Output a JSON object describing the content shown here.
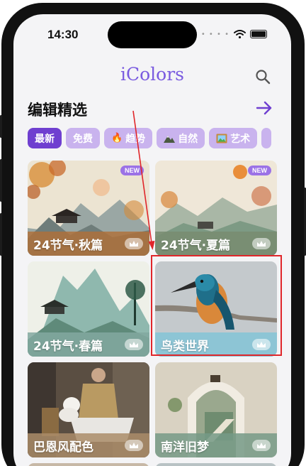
{
  "status_bar": {
    "time": "14:30"
  },
  "header": {
    "logo_text": "iColors",
    "search_icon": "search-icon"
  },
  "section": {
    "title": "编辑精选",
    "more_icon": "arrow-right-icon"
  },
  "chips": [
    {
      "label": "最新",
      "icon": "",
      "active": true
    },
    {
      "label": "免费",
      "icon": "",
      "active": false
    },
    {
      "label": "趋势",
      "icon": "fire-icon",
      "active": false
    },
    {
      "label": "自然",
      "icon": "mountain-icon",
      "active": false
    },
    {
      "label": "艺术",
      "icon": "framed-picture-icon",
      "active": false
    }
  ],
  "cards": [
    {
      "title": "24节气·秋篇",
      "badge": "NEW",
      "premium": true
    },
    {
      "title": "24节气·夏篇",
      "badge": "NEW",
      "premium": true
    },
    {
      "title": "24节气·春篇",
      "premium": true
    },
    {
      "title": "鸟类世界",
      "premium": true,
      "highlighted": true
    },
    {
      "title": "巴恩风配色",
      "premium": true
    },
    {
      "title": "南洋旧梦",
      "premium": true
    }
  ],
  "colors": {
    "accent": "#6f3fd0",
    "chip_inactive": "#c9b3ee",
    "annotation": "#e0262a"
  }
}
